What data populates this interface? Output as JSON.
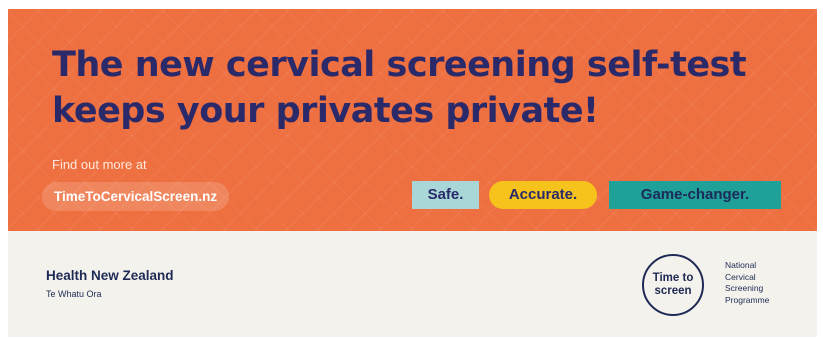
{
  "headline": "The new cervical screening self-test keeps your privates private!",
  "find_out": "Find out more at",
  "url": "TimeToCervicalScreen.nz",
  "tags": [
    "Safe.",
    "Accurate.",
    "Game-changer."
  ],
  "org": {
    "name": "Health New Zealand",
    "subname": "Te Whatu Ora"
  },
  "programme_logo": {
    "line1": "Time to",
    "line2": "screen",
    "caption": [
      "National",
      "Cervical",
      "Screening",
      "Programme"
    ]
  },
  "colors": {
    "hero_bg": "#ee6f3f",
    "navy": "#2a2a6a",
    "tag_safe": "#a9d7d8",
    "tag_accurate": "#f6c21c",
    "tag_game": "#1fa19a",
    "footer_bg": "#f4f2ec"
  }
}
